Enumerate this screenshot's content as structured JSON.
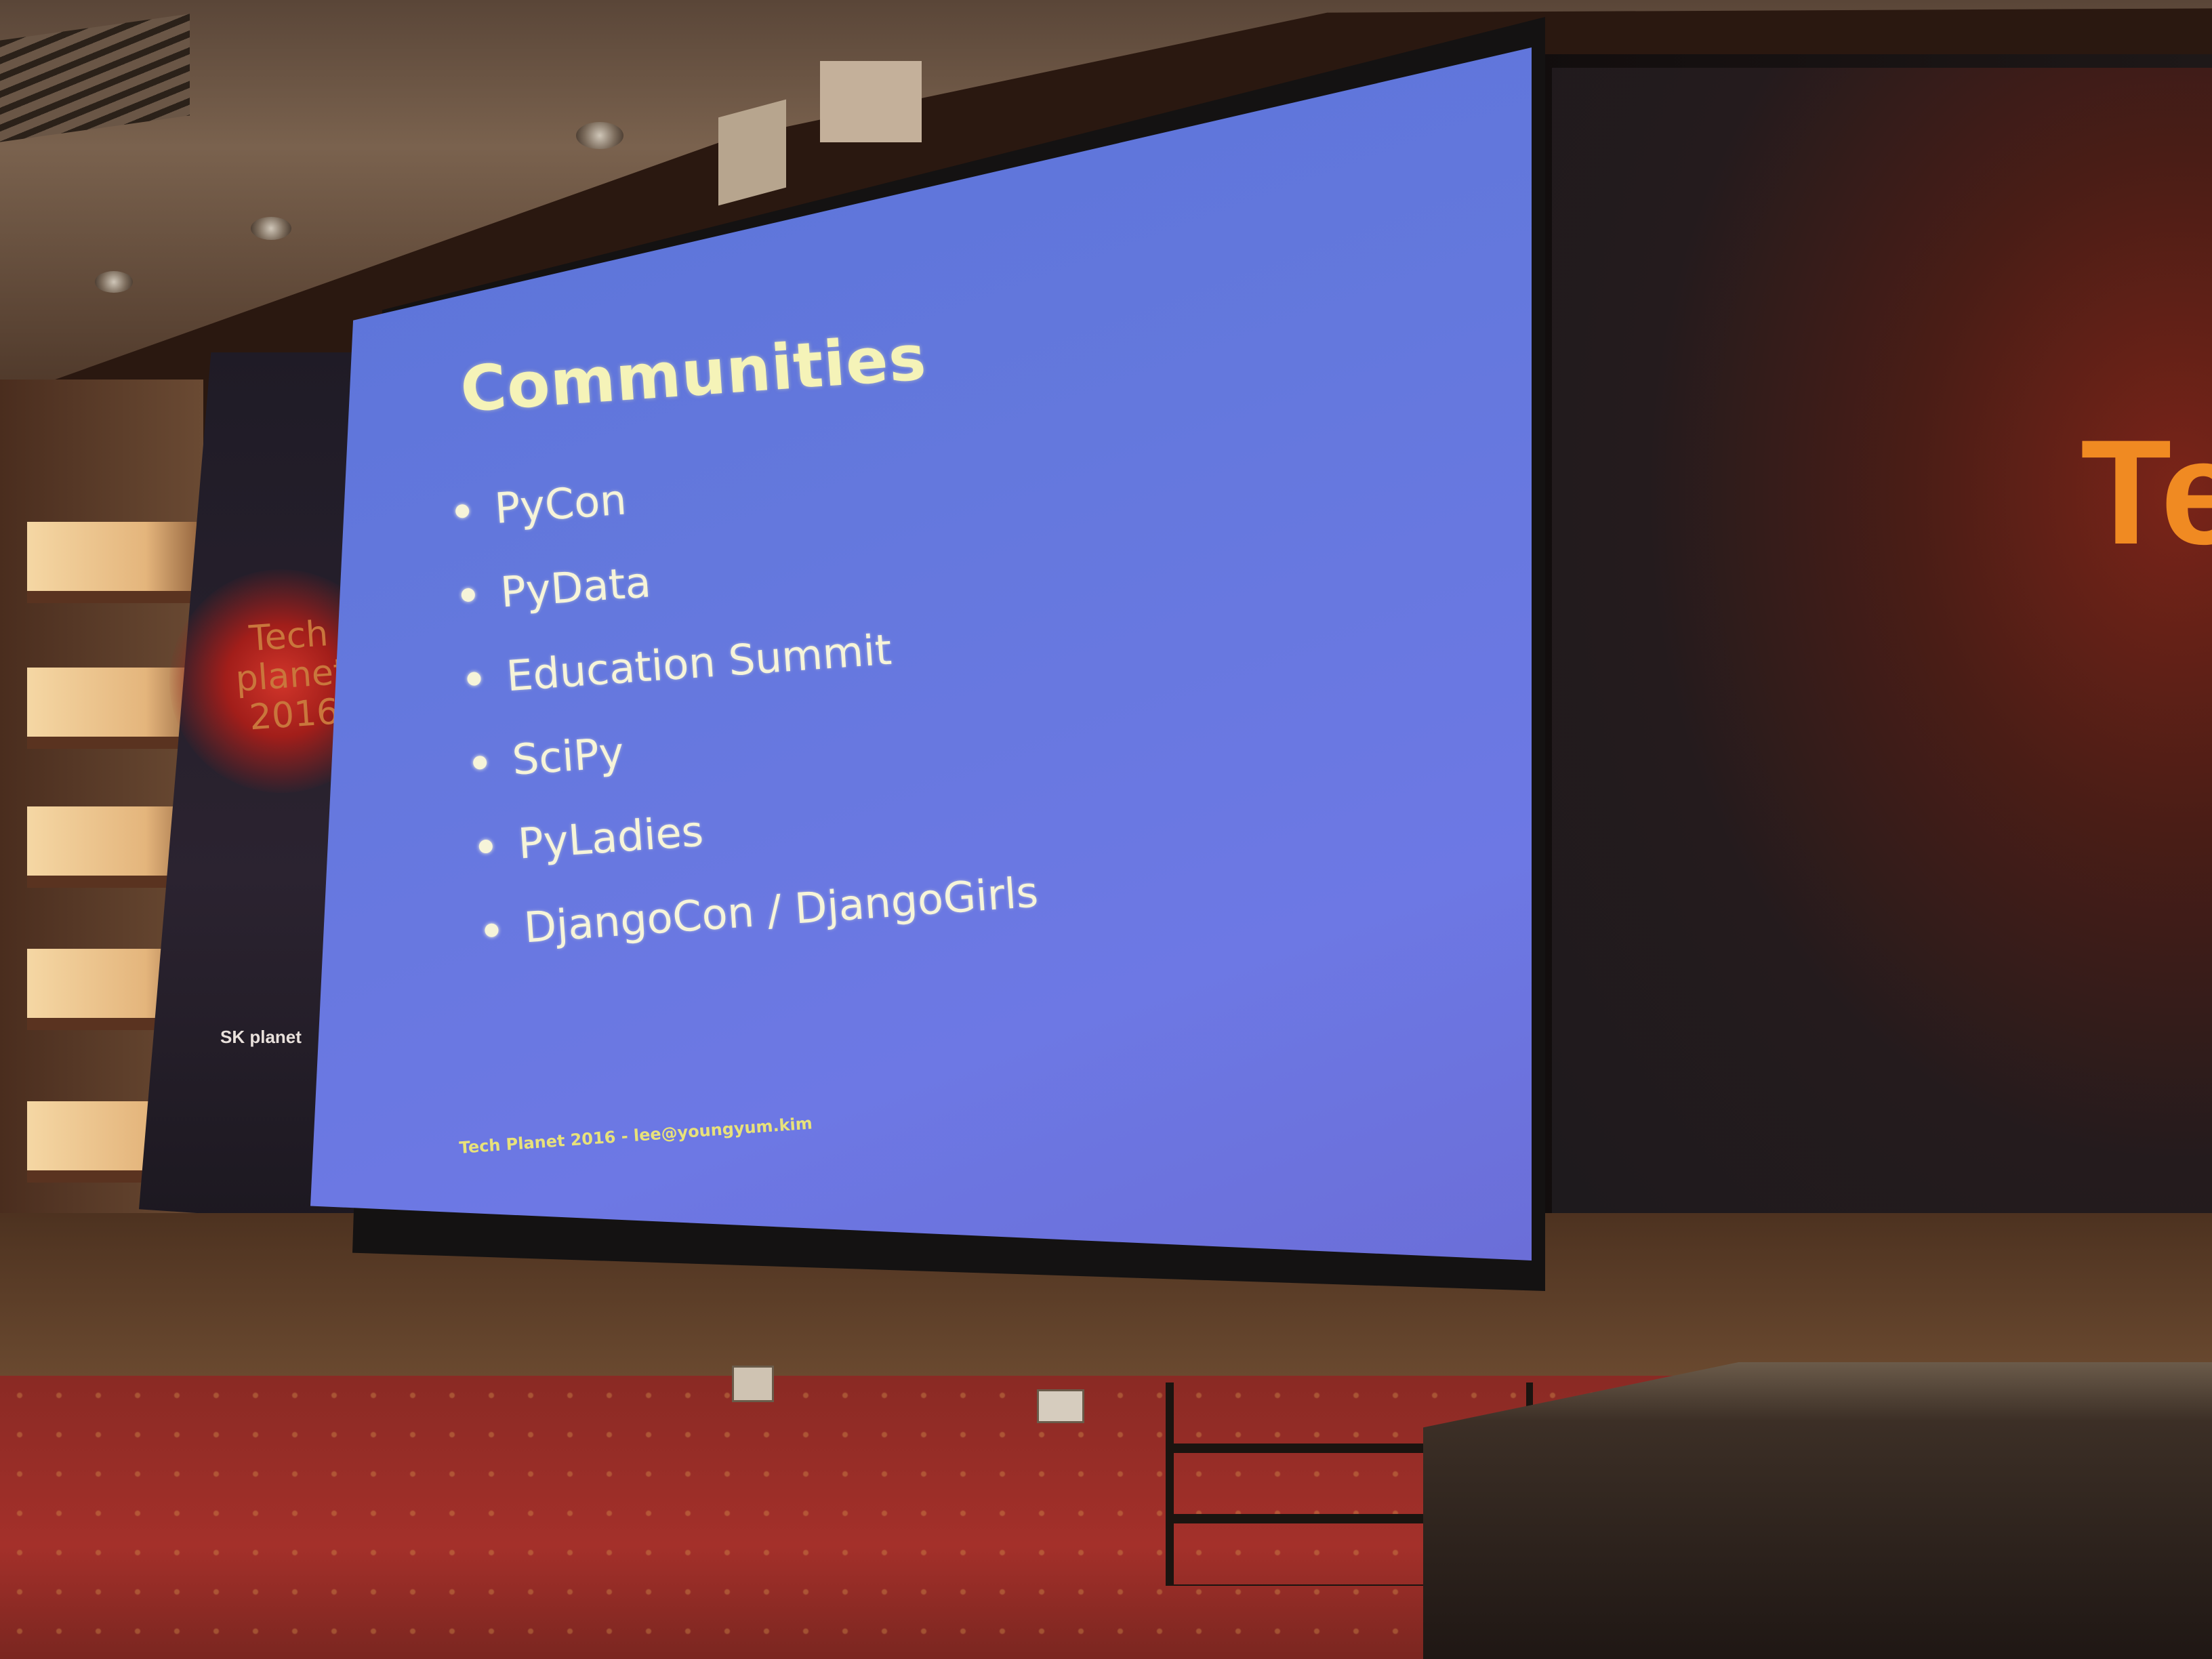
{
  "slide": {
    "title": "Communities",
    "bullets": [
      "PyCon",
      "PyData",
      "Education Summit",
      "SciPy",
      "PyLadies",
      "DjangoCon / DjangoGirls"
    ],
    "footer": "Tech Planet 2016 - lee@youngyum.kim"
  },
  "left_banner": {
    "line1": "Tech",
    "line2": "planet",
    "line3": "2016",
    "logo": "SK planet"
  },
  "right_screen": {
    "partial_text": "Te"
  },
  "colors": {
    "slide_background": "#6478dd",
    "slide_text": "#f6f4d9",
    "title_text": "#f5f3b8",
    "banner_accent": "#d1352a",
    "carpet": "#a4302a"
  }
}
